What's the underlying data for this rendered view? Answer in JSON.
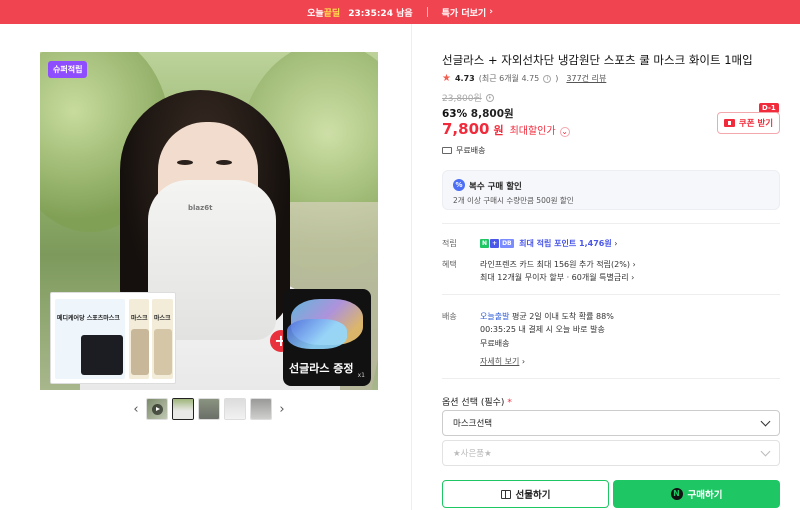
{
  "promo": {
    "brand_prefix": "오늘",
    "brand_highlight": "끝딜",
    "timer": "23:35:24 남음",
    "more_label": "특가 더보기",
    "more_chevron": "›"
  },
  "gallery": {
    "super_badge": "슈퍼적립",
    "package_labels": [
      "메디케어당 스포츠마스크",
      "마스크",
      "마스크"
    ],
    "gift_text": "선글라스 증정",
    "gift_small": "x1",
    "model_logo": "blaz6t",
    "prev_icon": "‹",
    "next_icon": "›",
    "plus_icon": "+"
  },
  "product": {
    "title": "선글라스 + 자외선차단 냉감원단 스포츠 쿨 마스크 화이트 1매입",
    "rating_star": "★",
    "rating": "4.73",
    "rating_recent": "(최근 6개월 4.75",
    "rating_recent_close": ")",
    "reviews": "377건 리뷰",
    "original_price": "23,800원",
    "discount_percent": "63%",
    "discount_price": "8,800원",
    "final_price": "7,800",
    "final_won": "원",
    "final_label": "최대할인가",
    "coupon_label": "쿠폰 받기",
    "coupon_tag": "D-1",
    "shipping_short": "무료배송",
    "info_glyph": "i",
    "chevron_glyph": "⌄"
  },
  "multi_buy": {
    "icon_label": "%",
    "title": "복수 구매 할인",
    "desc": "2개 이상 구매시 수량만큼 500원 할인"
  },
  "benefits": {
    "points_label": "적립",
    "npay_badges": [
      "N",
      "+",
      "DB"
    ],
    "points_text": "최대 적립 포인트 1,476원",
    "benefit_label": "혜택",
    "benefit_line1": "라인프렌즈 카드 최대 156원 추가 적립(2%)",
    "benefit_line2": "최대 12개월 무이자 할부 · 60개월 특별금리",
    "chevron": "›"
  },
  "delivery": {
    "label": "배송",
    "today": "오늘출발",
    "today_detail": "평균 2일 이내 도착 확률 88%",
    "cutoff_time": "00:35:25",
    "cutoff_detail": "내 결제 시 오늘 바로 발송",
    "fee": "무료배송",
    "details_link": "자세히 보기",
    "chevron": "›"
  },
  "options": {
    "label": "옵션 선택 (필수)",
    "required_mark": "*",
    "select1_value": "마스크선택",
    "select2_value": "★사은품★"
  },
  "actions": {
    "gift_button": "선물하기",
    "buy_button": "구매하기",
    "npay_logo": "N"
  },
  "colors": {
    "promo_bg": "#f04451",
    "accent_red": "#f02c3c",
    "naver_green": "#1ec764",
    "point_blue": "#4b57e8",
    "super_badge_purple": "#8e4dff"
  }
}
